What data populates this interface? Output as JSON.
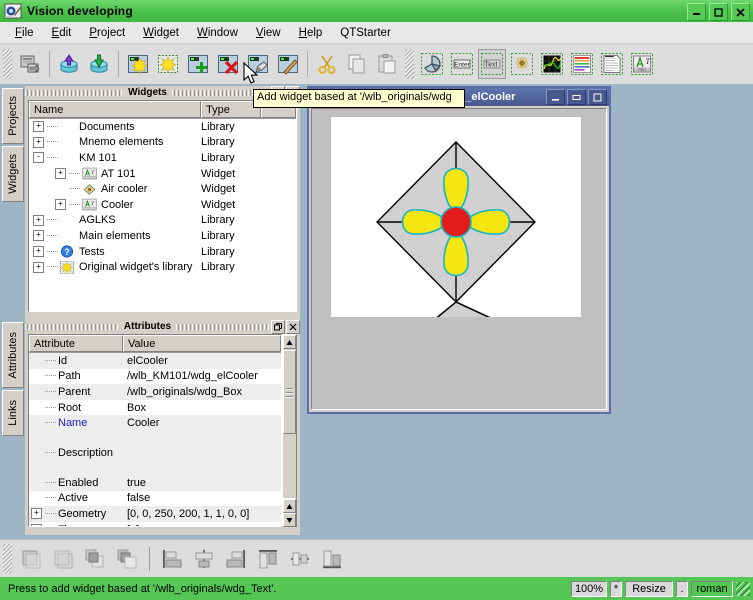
{
  "window": {
    "title": "Vision developing",
    "app_icon": "vision-app-icon",
    "minimize_label": "–",
    "maximize_label": "□",
    "close_label": "✕"
  },
  "menubar": {
    "items": [
      {
        "label": "File",
        "mnemonic": "F"
      },
      {
        "label": "Edit",
        "mnemonic": "E"
      },
      {
        "label": "Project",
        "mnemonic": "P"
      },
      {
        "label": "Widget",
        "mnemonic": "W"
      },
      {
        "label": "Window",
        "mnemonic": "W"
      },
      {
        "label": "View",
        "mnemonic": "V"
      },
      {
        "label": "Help",
        "mnemonic": "H"
      },
      {
        "label": "QTStarter",
        "mnemonic": ""
      }
    ]
  },
  "toolbar": {
    "buttons": [
      {
        "name": "open-project-icon",
        "title": "Open project"
      },
      {
        "name": "load-from-db-icon",
        "title": "Load from DB"
      },
      {
        "name": "save-to-db-icon",
        "title": "Save to DB"
      },
      {
        "name": "new-widget-icon",
        "title": "New widget"
      },
      {
        "name": "new-library-icon",
        "title": "New library"
      },
      {
        "name": "add-widget-icon",
        "title": "Add widget"
      },
      {
        "name": "delete-widget-icon",
        "title": "Delete widget"
      },
      {
        "name": "edit-widget-icon",
        "title": "Edit widget"
      },
      {
        "name": "properties-icon",
        "title": "Properties"
      },
      {
        "name": "cut-icon",
        "title": "Cut"
      },
      {
        "name": "copy-icon",
        "title": "Copy"
      },
      {
        "name": "paste-icon",
        "title": "Paste"
      },
      {
        "name": "primitive-shape-icon",
        "title": "Elementary figure"
      },
      {
        "name": "primitive-enter-icon",
        "title": "Form element"
      },
      {
        "name": "primitive-text-icon",
        "title": "Text",
        "pressed": true
      },
      {
        "name": "primitive-media-icon",
        "title": "Media"
      },
      {
        "name": "primitive-diagram-icon",
        "title": "Diagram"
      },
      {
        "name": "primitive-protocol-icon",
        "title": "Protocol"
      },
      {
        "name": "primitive-document-icon",
        "title": "Document"
      },
      {
        "name": "primitive-box-icon",
        "title": "Box"
      }
    ]
  },
  "tooltip": {
    "text": "Add widget based at '/wlb_originals/wdg"
  },
  "vertical_tabs": [
    {
      "label": "Projects",
      "name": "tab-projects"
    },
    {
      "label": "Widgets",
      "name": "tab-widgets",
      "active": true
    },
    {
      "label": "Attributes",
      "name": "tab-attributes",
      "active": true
    },
    {
      "label": "Links",
      "name": "tab-links"
    }
  ],
  "widgets_panel": {
    "title": "Widgets",
    "float_label": "❐",
    "close_label": "✕",
    "columns": [
      "Name",
      "Type"
    ],
    "rows": [
      {
        "indent": 0,
        "expander": "+",
        "icon": "",
        "name": "Documents",
        "type": "Library"
      },
      {
        "indent": 0,
        "expander": "+",
        "icon": "",
        "name": "Mnemo elements",
        "type": "Library"
      },
      {
        "indent": 0,
        "expander": "-",
        "icon": "",
        "name": "KM 101",
        "type": "Library"
      },
      {
        "indent": 1,
        "expander": "+",
        "icon": "at-value-icon",
        "name": "AT 101",
        "type": "Widget"
      },
      {
        "indent": 1,
        "expander": "",
        "icon": "air-cooler-icon",
        "name": "Air cooler",
        "type": "Widget"
      },
      {
        "indent": 1,
        "expander": "+",
        "icon": "at-value-icon",
        "name": "Cooler",
        "type": "Widget"
      },
      {
        "indent": 0,
        "expander": "+",
        "icon": "",
        "name": "AGLKS",
        "type": "Library"
      },
      {
        "indent": 0,
        "expander": "+",
        "icon": "",
        "name": "Main elements",
        "type": "Library"
      },
      {
        "indent": 0,
        "expander": "+",
        "icon": "help-icon",
        "name": "Tests",
        "type": "Library"
      },
      {
        "indent": 0,
        "expander": "+",
        "icon": "star-icon",
        "name": "Original widget's library",
        "type": "Library"
      }
    ]
  },
  "attributes_panel": {
    "title": "Attributes",
    "float_label": "❐",
    "close_label": "✕",
    "columns": [
      "Attribute",
      "Value"
    ],
    "rows": [
      {
        "expander": "",
        "name": "Id",
        "value": "elCooler",
        "highlight": false,
        "tall": false
      },
      {
        "expander": "",
        "name": "Path",
        "value": "/wlb_KM101/wdg_elCooler",
        "highlight": false,
        "tall": false
      },
      {
        "expander": "",
        "name": "Parent",
        "value": "/wlb_originals/wdg_Box",
        "highlight": false,
        "tall": false
      },
      {
        "expander": "",
        "name": "Root",
        "value": "Box",
        "highlight": false,
        "tall": false
      },
      {
        "expander": "",
        "name": "Name",
        "value": "Cooler",
        "highlight": true,
        "tall": false
      },
      {
        "expander": "",
        "name": "Description",
        "value": "",
        "highlight": false,
        "tall": true
      },
      {
        "expander": "",
        "name": "Enabled",
        "value": "true",
        "highlight": false,
        "tall": false
      },
      {
        "expander": "",
        "name": "Active",
        "value": "false",
        "highlight": false,
        "tall": false
      },
      {
        "expander": "+",
        "name": "Geometry",
        "value": "[0, 0, 250, 200, 1, 1, 0, 0]",
        "highlight": false,
        "tall": false
      },
      {
        "expander": "+",
        "name": "Tip",
        "value": "[, ]",
        "highlight": false,
        "tall": false
      }
    ]
  },
  "widget_editor": {
    "title": "Widget: /wlb_KM101/wdg_elCooler",
    "icon": "at-value-icon",
    "minimize_label": "–",
    "maximize_label": "▭",
    "restore_label": "▲",
    "canvas": {
      "name": "cooler-drawing",
      "shapes": "diamond-fan-with-stand"
    }
  },
  "bottom_toolbar": {
    "buttons": [
      {
        "name": "raise-to-top-icon"
      },
      {
        "name": "lower-to-bottom-icon"
      },
      {
        "name": "raise-one-icon"
      },
      {
        "name": "lower-one-icon"
      },
      {
        "name": "align-left-icon"
      },
      {
        "name": "align-center-h-icon"
      },
      {
        "name": "align-right-icon"
      },
      {
        "name": "align-top-icon"
      },
      {
        "name": "align-center-v-icon"
      },
      {
        "name": "align-bottom-icon"
      }
    ]
  },
  "statusbar": {
    "message": "Press to add widget based at '/wlb_originals/wdg_Text'.",
    "zoom": "100%",
    "asterisk": "*",
    "mode": "Resize",
    "dot": ".",
    "font": "roman"
  }
}
